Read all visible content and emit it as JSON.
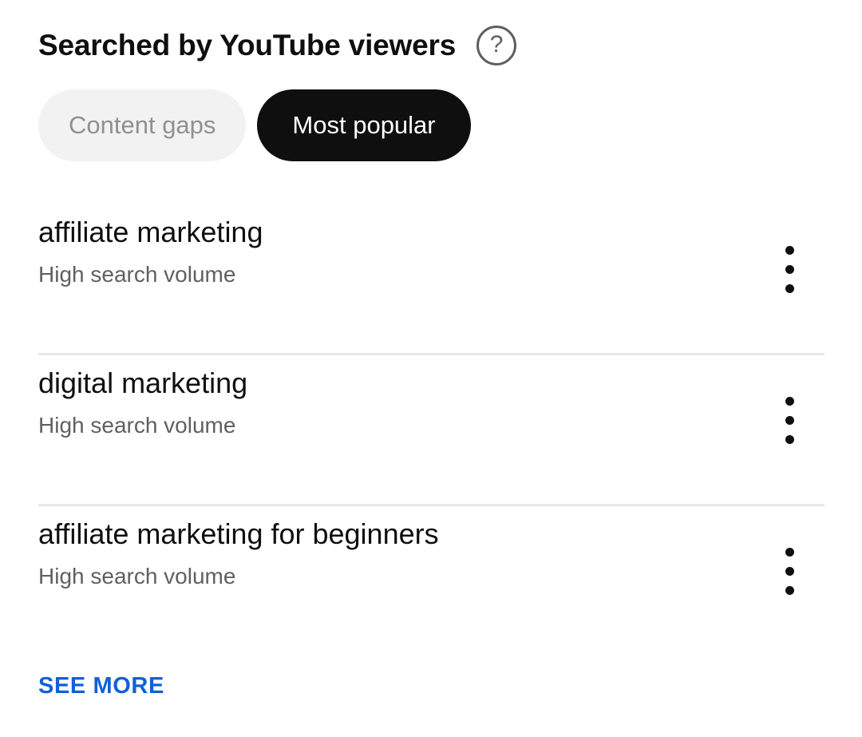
{
  "header": {
    "title": "Searched by YouTube viewers",
    "help_icon": "help-circle-icon",
    "help_glyph": "?"
  },
  "filters": {
    "chips": [
      {
        "label": "Content gaps",
        "selected": false
      },
      {
        "label": "Most popular",
        "selected": true
      }
    ]
  },
  "list": {
    "items": [
      {
        "keyword": "affiliate marketing",
        "volume_label": "High search volume",
        "menu_icon": "more-vertical-icon"
      },
      {
        "keyword": "digital marketing",
        "volume_label": "High search volume",
        "menu_icon": "more-vertical-icon"
      },
      {
        "keyword": "affiliate marketing for beginners",
        "volume_label": "High search volume",
        "menu_icon": "more-vertical-icon"
      }
    ]
  },
  "footer": {
    "see_more_label": "SEE MORE"
  },
  "colors": {
    "background": "#ffffff",
    "text_primary": "#0f0f0f",
    "text_secondary": "#606060",
    "chip_inactive_bg": "#f2f2f2",
    "chip_inactive_text": "#909090",
    "chip_active_bg": "#0f0f0f",
    "chip_active_text": "#ffffff",
    "divider": "#e8e8e8",
    "link_blue": "#1260d6",
    "help_icon_stroke": "#5f5f5f"
  }
}
